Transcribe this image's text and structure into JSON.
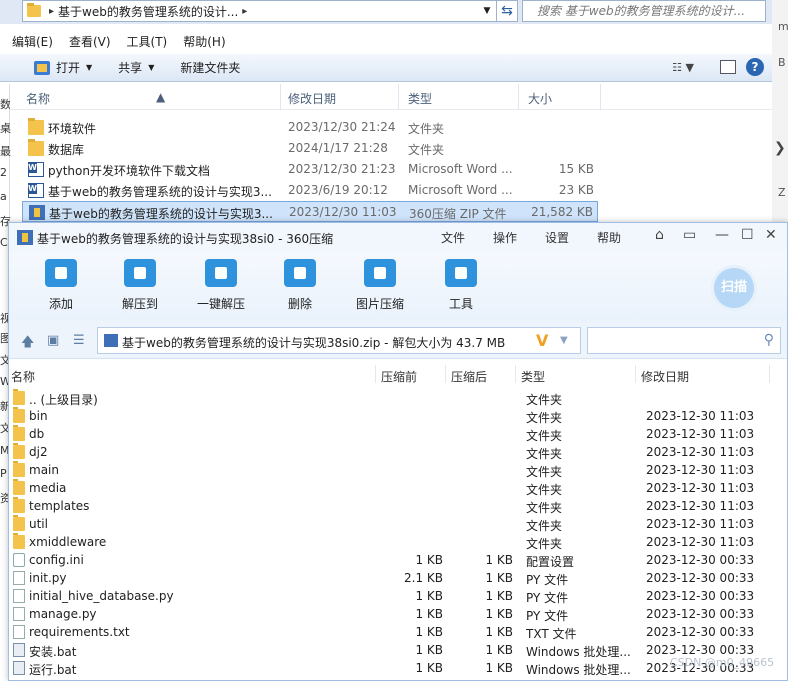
{
  "explorer": {
    "address": "基于web的教务管理系统的设计...",
    "search_placeholder": "搜索 基于web的教务管理系统的设计...",
    "menu": [
      "编辑(E)",
      "查看(V)",
      "工具(T)",
      "帮助(H)"
    ],
    "toolbar": {
      "open": "打开",
      "share": "共享",
      "new_folder": "新建文件夹"
    },
    "columns": {
      "name": "名称",
      "date": "修改日期",
      "type": "类型",
      "size": "大小"
    },
    "files": [
      {
        "name": "环境软件",
        "date": "2023/12/30 21:24",
        "type": "文件夹",
        "size": "",
        "icon": "folder"
      },
      {
        "name": "数据库",
        "date": "2024/1/17 21:28",
        "type": "文件夹",
        "size": "",
        "icon": "folder"
      },
      {
        "name": "python开发环境软件下载文档",
        "date": "2023/12/30 21:23",
        "type": "Microsoft Word ...",
        "size": "15 KB",
        "icon": "word"
      },
      {
        "name": "基于web的教务管理系统的设计与实现3...",
        "date": "2023/6/19 20:12",
        "type": "Microsoft Word ...",
        "size": "23 KB",
        "icon": "word"
      },
      {
        "name": "基于web的教务管理系统的设计与实现3...",
        "date": "2023/12/30 11:03",
        "type": "360压缩 ZIP 文件",
        "size": "21,582 KB",
        "icon": "zip",
        "selected": true
      }
    ],
    "left_chars": [
      "数",
      "桌",
      "最",
      "2",
      "a",
      "存",
      "C",
      "视",
      "图",
      "文",
      "W",
      "新",
      "文",
      "M",
      "P",
      "资"
    ],
    "right_chars": [
      "m",
      "B",
      "",
      "Z"
    ]
  },
  "zip": {
    "title": "基于web的教务管理系统的设计与实现38si0 - 360压缩",
    "menu": [
      "文件",
      "操作",
      "设置",
      "帮助"
    ],
    "tools": [
      "添加",
      "解压到",
      "一键解压",
      "删除",
      "图片压缩",
      "工具"
    ],
    "scan_label": "扫描",
    "path": "基于web的教务管理系统的设计与实现38si0.zip - 解包大小为 43.7 MB",
    "columns": {
      "name": "名称",
      "before": "压缩前",
      "after": "压缩后",
      "type": "类型",
      "date": "修改日期"
    },
    "rows": [
      {
        "name": ".. (上级目录)",
        "before": "",
        "after": "",
        "type": "文件夹",
        "date": "",
        "icon": "folder"
      },
      {
        "name": "bin",
        "before": "",
        "after": "",
        "type": "文件夹",
        "date": "2023-12-30 11:03",
        "icon": "folder"
      },
      {
        "name": "db",
        "before": "",
        "after": "",
        "type": "文件夹",
        "date": "2023-12-30 11:03",
        "icon": "folder"
      },
      {
        "name": "dj2",
        "before": "",
        "after": "",
        "type": "文件夹",
        "date": "2023-12-30 11:03",
        "icon": "folder"
      },
      {
        "name": "main",
        "before": "",
        "after": "",
        "type": "文件夹",
        "date": "2023-12-30 11:03",
        "icon": "folder"
      },
      {
        "name": "media",
        "before": "",
        "after": "",
        "type": "文件夹",
        "date": "2023-12-30 11:03",
        "icon": "folder"
      },
      {
        "name": "templates",
        "before": "",
        "after": "",
        "type": "文件夹",
        "date": "2023-12-30 11:03",
        "icon": "folder"
      },
      {
        "name": "util",
        "before": "",
        "after": "",
        "type": "文件夹",
        "date": "2023-12-30 11:03",
        "icon": "folder"
      },
      {
        "name": "xmiddleware",
        "before": "",
        "after": "",
        "type": "文件夹",
        "date": "2023-12-30 11:03",
        "icon": "folder"
      },
      {
        "name": "config.ini",
        "before": "1 KB",
        "after": "1 KB",
        "type": "配置设置",
        "date": "2023-12-30 00:33",
        "icon": "gear"
      },
      {
        "name": "init.py",
        "before": "2.1 KB",
        "after": "1 KB",
        "type": "PY 文件",
        "date": "2023-12-30 00:33",
        "icon": "doc"
      },
      {
        "name": "initial_hive_database.py",
        "before": "1 KB",
        "after": "1 KB",
        "type": "PY 文件",
        "date": "2023-12-30 00:33",
        "icon": "doc"
      },
      {
        "name": "manage.py",
        "before": "1 KB",
        "after": "1 KB",
        "type": "PY 文件",
        "date": "2023-12-30 00:33",
        "icon": "doc"
      },
      {
        "name": "requirements.txt",
        "before": "1 KB",
        "after": "1 KB",
        "type": "TXT 文件",
        "date": "2023-12-30 00:33",
        "icon": "doc"
      },
      {
        "name": "安装.bat",
        "before": "1 KB",
        "after": "1 KB",
        "type": "Windows 批处理...",
        "date": "2023-12-30 00:33",
        "icon": "bat"
      },
      {
        "name": "运行.bat",
        "before": "1 KB",
        "after": "1 KB",
        "type": "Windows 批处理...",
        "date": "2023-12-30 00:33",
        "icon": "bat"
      }
    ]
  },
  "watermark": "CSDN @m0_49665"
}
